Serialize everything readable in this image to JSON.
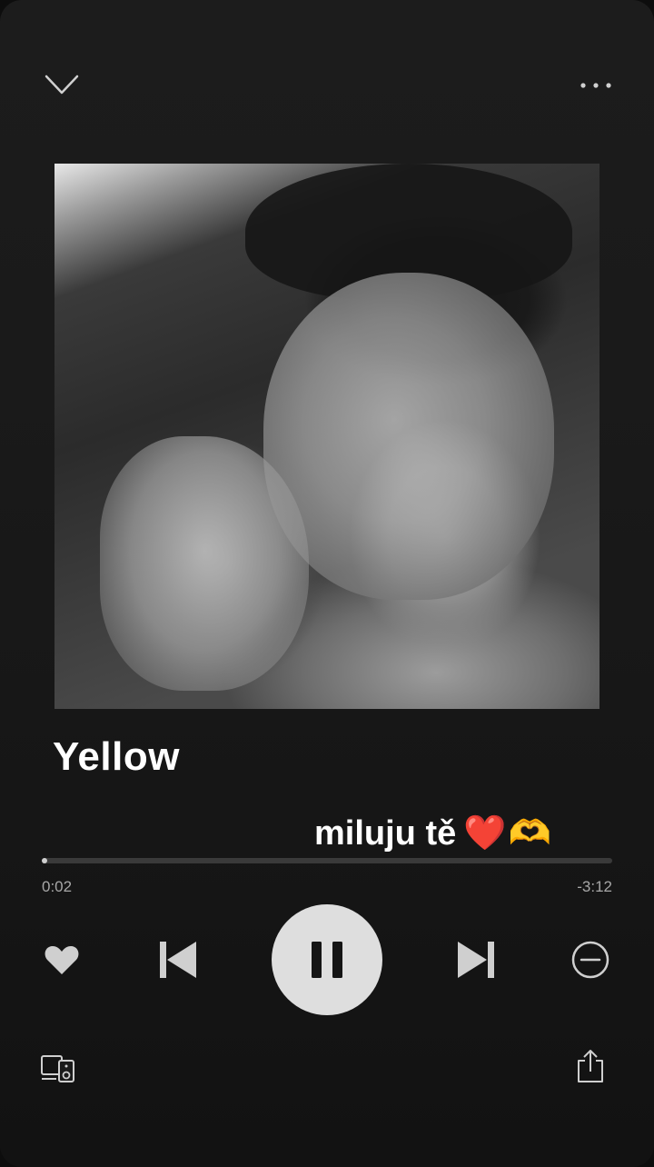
{
  "header": {
    "collapse_icon": "chevron-down-icon",
    "more_icon": "more-horizontal-icon"
  },
  "track": {
    "title": "Yellow",
    "overlay_text": "miluju tě",
    "overlay_emoji_heart": "❤️",
    "overlay_emoji_hands": "🫶"
  },
  "playback": {
    "elapsed": "0:02",
    "remaining": "-3:12",
    "progress_fraction": 0.01
  },
  "controls": {
    "like_icon": "heart-icon",
    "previous_icon": "skip-previous-icon",
    "play_pause_icon": "pause-icon",
    "next_icon": "skip-next-icon",
    "remove_icon": "minus-circle-icon",
    "devices_icon": "devices-icon",
    "share_icon": "share-icon"
  },
  "colors": {
    "background": "#121212",
    "control_fill": "#dedede",
    "heart_emoji": "#e0202e"
  }
}
